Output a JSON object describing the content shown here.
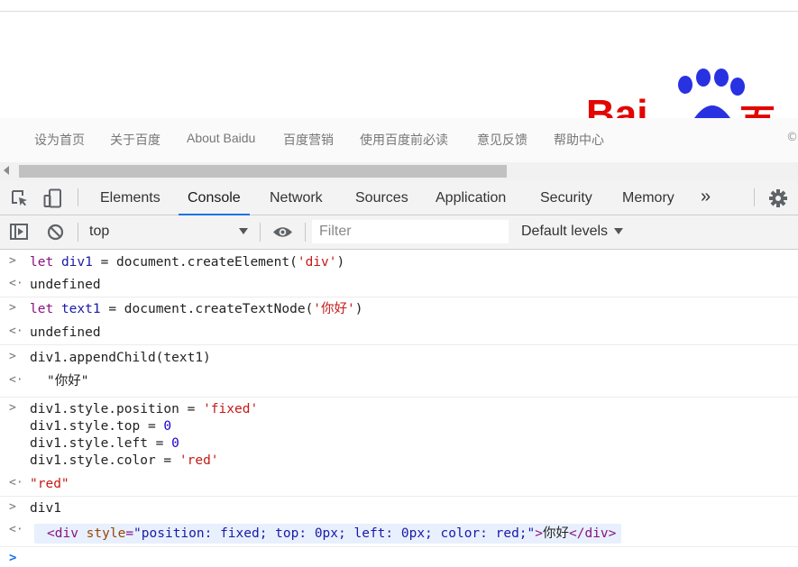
{
  "page": {
    "logo_text_left": "Bai",
    "logo_text_right": "百度",
    "footer_links": [
      "设为首页",
      "关于百度",
      "About Baidu",
      "百度营销",
      "使用百度前必读",
      "意见反馈",
      "帮助中心"
    ],
    "footer_copyright": "©"
  },
  "devtools": {
    "tabs": [
      "Elements",
      "Console",
      "Network",
      "Sources",
      "Application",
      "Security",
      "Memory"
    ],
    "active_tab": "Console",
    "more_tabs": "»",
    "toolbar": {
      "context": "top",
      "filter_placeholder": "Filter",
      "levels": "Default levels"
    }
  },
  "console": {
    "entries": [
      {
        "type": "input",
        "text": "let div1 = document.createElement('div')"
      },
      {
        "type": "output",
        "text": "undefined"
      },
      {
        "type": "input",
        "text": "let text1 = document.createTextNode('你好')"
      },
      {
        "type": "output",
        "text": "undefined"
      },
      {
        "type": "input",
        "text": "div1.appendChild(text1)"
      },
      {
        "type": "output",
        "text": "\"你好\""
      },
      {
        "type": "input",
        "lines": [
          "div1.style.position = 'fixed'",
          "div1.style.top = 0",
          "div1.style.left = 0",
          "div1.style.color = 'red'"
        ]
      },
      {
        "type": "output",
        "text": "\"red\""
      },
      {
        "type": "input",
        "text": "div1"
      },
      {
        "type": "output",
        "text": "<div style=\"position: fixed; top: 0px; left: 0px; color: red;\">你好</div>"
      }
    ],
    "tokens": {
      "e1_kw": "let",
      "e1_var": "div1",
      "e1_mid": " = document.createElement(",
      "e1_str": "'div'",
      "e1_end": ")",
      "e2_kw": "let",
      "e2_var": "text1",
      "e2_mid": " = document.createTextNode(",
      "e2_str": "'你好'",
      "e2_end": ")",
      "e3": "div1.appendChild(text1)",
      "e3_out": "\"你好\"",
      "e4_l1a": "div1.style.position = ",
      "e4_l1b": "'fixed'",
      "e4_l2a": "div1.style.top = ",
      "e4_l2b": "0",
      "e4_l3a": "div1.style.left = ",
      "e4_l3b": "0",
      "e4_l4a": "div1.style.color = ",
      "e4_l4b": "'red'",
      "e4_out": "\"red\"",
      "e5": "div1",
      "el_open": "<div",
      "el_attr": " style",
      "el_eq": "=",
      "el_val": "\"position: fixed; top: 0px; left: 0px; color: red;\"",
      "el_close1": ">",
      "el_text": "你好",
      "el_close2": "</div>",
      "undef": "undefined"
    }
  }
}
